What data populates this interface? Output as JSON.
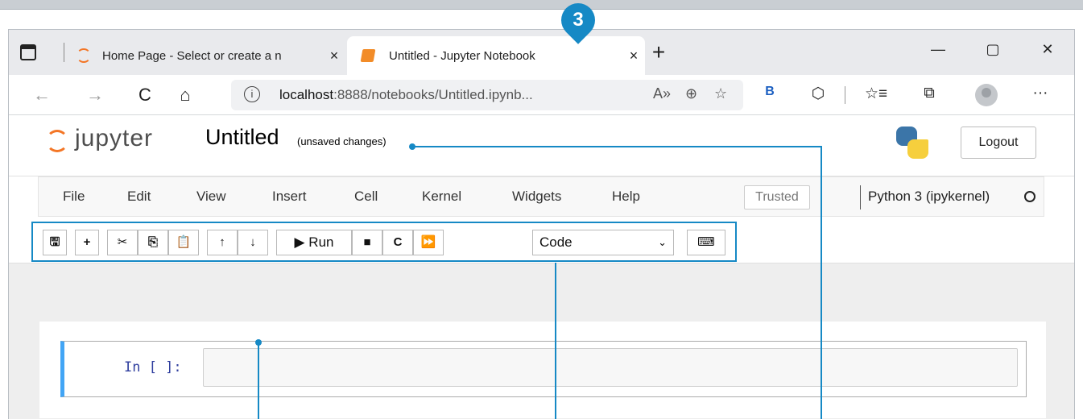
{
  "callout": {
    "number": "3"
  },
  "tabs": [
    {
      "title": "Home Page - Select or create a n",
      "close": "×"
    },
    {
      "title": "Untitled - Jupyter Notebook",
      "close": "×"
    }
  ],
  "tabstrip": {
    "new_tab": "+",
    "minimize": "—",
    "maximize": "▢",
    "close": "✕"
  },
  "address_bar": {
    "back": "←",
    "forward": "→",
    "refresh": "C",
    "home": "⌂",
    "info": "i",
    "url_host": "localhost",
    "url_rest": ":8888/notebooks/Untitled.ipynb...",
    "read_aloud": "A»",
    "zoom": "⊕",
    "favorite_add": "☆",
    "bing": "B",
    "extensions": "⬡",
    "favorites": "☆≡",
    "collections": "⧉",
    "more": "···"
  },
  "jupyter": {
    "logo_text": "jupyter",
    "notebook_name": "Untitled",
    "save_status": "(unsaved changes)",
    "logout": "Logout"
  },
  "menu": {
    "items": [
      "File",
      "Edit",
      "View",
      "Insert",
      "Cell",
      "Kernel",
      "Widgets",
      "Help"
    ],
    "trusted": "Trusted",
    "kernel": "Python 3 (ipykernel)"
  },
  "toolbar": {
    "save": "🖫",
    "insert": "+",
    "cut": "✂",
    "copy": "⎘",
    "paste": "📋",
    "move_up": "↑",
    "move_down": "↓",
    "run": "▶ Run",
    "interrupt": "■",
    "restart": "C",
    "run_all": "⏩",
    "cell_type": "Code",
    "cell_type_caret": "⌄",
    "keyboard": "⌨"
  },
  "cell": {
    "prompt": "In [ ]:"
  }
}
